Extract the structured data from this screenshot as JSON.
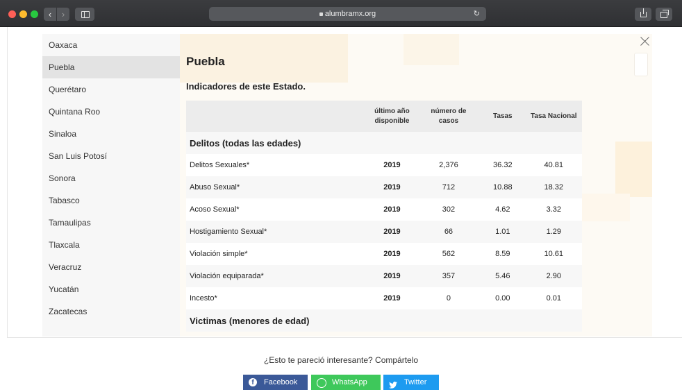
{
  "browser": {
    "url": "alumbramx.org"
  },
  "states": [
    {
      "label": "Oaxaca",
      "active": false
    },
    {
      "label": "Puebla",
      "active": true
    },
    {
      "label": "Querétaro",
      "active": false
    },
    {
      "label": "Quintana Roo",
      "active": false
    },
    {
      "label": "Sinaloa",
      "active": false
    },
    {
      "label": "San Luis Potosí",
      "active": false
    },
    {
      "label": "Sonora",
      "active": false
    },
    {
      "label": "Tabasco",
      "active": false
    },
    {
      "label": "Tamaulipas",
      "active": false
    },
    {
      "label": "Tlaxcala",
      "active": false
    },
    {
      "label": "Veracruz",
      "active": false
    },
    {
      "label": "Yucatán",
      "active": false
    },
    {
      "label": "Zacatecas",
      "active": false
    }
  ],
  "detail": {
    "title": "Puebla",
    "subtitle": "Indicadores de este Estado.",
    "columns": {
      "year": "último año disponible",
      "cases": "número de casos",
      "rate": "Tasas",
      "national": "Tasa Nacional"
    },
    "section1": "Delitos (todas las edades)",
    "section2": "Victimas (menores de edad)",
    "rows": [
      {
        "name": "Delitos Sexuales*",
        "year": "2019",
        "cases": "2,376",
        "rate": "36.32",
        "national": "40.81"
      },
      {
        "name": "Abuso Sexual*",
        "year": "2019",
        "cases": "712",
        "rate": "10.88",
        "national": "18.32"
      },
      {
        "name": "Acoso Sexual*",
        "year": "2019",
        "cases": "302",
        "rate": "4.62",
        "national": "3.32"
      },
      {
        "name": "Hostigamiento Sexual*",
        "year": "2019",
        "cases": "66",
        "rate": "1.01",
        "national": "1.29"
      },
      {
        "name": "Violación simple*",
        "year": "2019",
        "cases": "562",
        "rate": "8.59",
        "national": "10.61"
      },
      {
        "name": "Violación equiparada*",
        "year": "2019",
        "cases": "357",
        "rate": "5.46",
        "national": "2.90"
      },
      {
        "name": "Incesto*",
        "year": "2019",
        "cases": "0",
        "rate": "0.00",
        "national": "0.01"
      }
    ]
  },
  "share": {
    "prompt": "¿Esto te pareció interesante? Compártelo",
    "facebook": "Facebook",
    "whatsapp": "WhatsApp",
    "twitter": "Twitter"
  },
  "colors": {
    "facebook": "#3b5998",
    "whatsapp": "#3ec85b",
    "twitter": "#1d9bf0",
    "active_item": "#e3e3e3"
  }
}
